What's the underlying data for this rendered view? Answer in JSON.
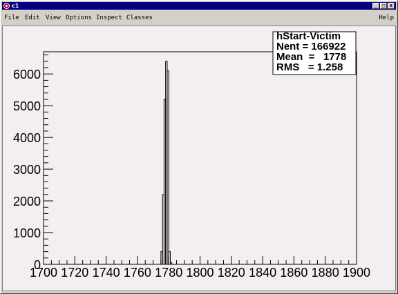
{
  "window": {
    "title": "c1"
  },
  "menu": {
    "file": "File",
    "edit": "Edit",
    "view": "View",
    "options": "Options",
    "inspect": "Inspect",
    "classes": "Classes",
    "help": "Help"
  },
  "controls": {
    "minimize": "_",
    "maximize": "□",
    "close": "x"
  },
  "stats": {
    "name": "hStart-Victim",
    "entries": "Nent = 166922",
    "mean": "Mean  =   1778",
    "rms": "RMS   = 1.258"
  },
  "colors": {
    "frame_line": "#000000",
    "canvas_bg": "#f2eef2",
    "titlebar": "#000080"
  },
  "chart_data": {
    "type": "bar",
    "title": "",
    "xlabel": "",
    "ylabel": "",
    "xlim": [
      1700,
      1900
    ],
    "ylim": [
      0,
      6700
    ],
    "x_ticks": [
      1700,
      1720,
      1740,
      1760,
      1780,
      1800,
      1820,
      1840,
      1860,
      1880,
      1900
    ],
    "x_tick_labels": [
      "1700",
      "1720",
      "1740",
      "1760",
      "1780",
      "1800",
      "1820",
      "1840",
      "1860",
      "1880",
      "1900"
    ],
    "y_ticks": [
      0,
      1000,
      2000,
      3000,
      4000,
      5000,
      6000
    ],
    "y_tick_labels": [
      "0",
      "1000",
      "2000",
      "3000",
      "4000",
      "5000",
      "6000"
    ],
    "histogram": {
      "bin_width": 1,
      "bin_starts": [
        1774,
        1775,
        1776,
        1777,
        1778,
        1779,
        1780,
        1781,
        1782
      ],
      "values": [
        0,
        400,
        2200,
        5200,
        6400,
        6100,
        400,
        50,
        0
      ]
    },
    "legend_position": "top-right"
  }
}
